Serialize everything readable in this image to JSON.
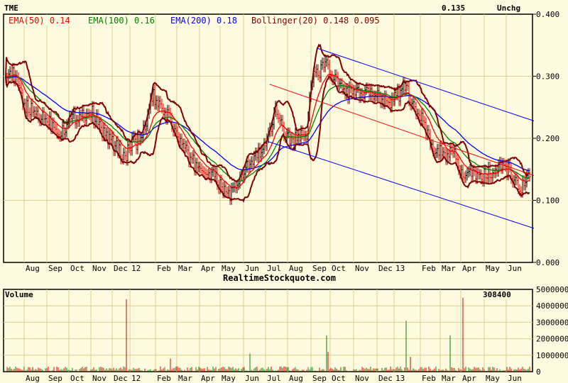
{
  "header": {
    "symbol": "TME",
    "last": "0.135",
    "change": "Unchg"
  },
  "legend": [
    {
      "label": "EMA(50)",
      "value": "0.14",
      "color": "#ff0000"
    },
    {
      "label": "EMA(100)",
      "value": "0.16",
      "color": "#008000"
    },
    {
      "label": "EMA(200)",
      "value": "0.18",
      "color": "#0000ff"
    },
    {
      "label": "Bollinger(20)",
      "value": "0.148 0.095",
      "color": "#800000"
    }
  ],
  "watermark": "RealtimeStockquote.com",
  "chart_data": [
    {
      "type": "line",
      "title": "TME",
      "x_tick_labels": [
        "Aug",
        "Sep",
        "Oct",
        "Nov",
        "Dec",
        "12",
        "Feb",
        "Mar",
        "Apr",
        "May",
        "Jun",
        "Jul",
        "Aug",
        "Sep",
        "Oct",
        "Nov",
        "Dec",
        "13",
        "Feb",
        "Mar",
        "Apr",
        "May",
        "Jun"
      ],
      "x_tick_days": [
        30,
        62,
        93,
        124,
        154,
        179,
        215,
        245,
        277,
        306,
        339,
        370,
        401,
        434,
        461,
        494,
        527,
        551,
        588,
        616,
        645,
        678,
        709
      ],
      "y_ticks": [
        "0.000",
        "0.100",
        "0.200",
        "0.300",
        "0.400"
      ],
      "ylim": [
        0,
        0.4
      ],
      "grid": true,
      "close_points": [
        [
          0,
          0.31
        ],
        [
          12,
          0.3
        ],
        [
          28,
          0.25
        ],
        [
          42,
          0.24
        ],
        [
          60,
          0.23
        ],
        [
          77,
          0.21
        ],
        [
          91,
          0.23
        ],
        [
          107,
          0.24
        ],
        [
          122,
          0.24
        ],
        [
          137,
          0.21
        ],
        [
          152,
          0.19
        ],
        [
          167,
          0.17
        ],
        [
          177,
          0.19
        ],
        [
          192,
          0.2
        ],
        [
          207,
          0.27
        ],
        [
          213,
          0.25
        ],
        [
          227,
          0.24
        ],
        [
          243,
          0.2
        ],
        [
          257,
          0.17
        ],
        [
          275,
          0.15
        ],
        [
          292,
          0.14
        ],
        [
          304,
          0.12
        ],
        [
          317,
          0.11
        ],
        [
          327,
          0.12
        ],
        [
          337,
          0.15
        ],
        [
          352,
          0.17
        ],
        [
          368,
          0.19
        ],
        [
          382,
          0.25
        ],
        [
          392,
          0.21
        ],
        [
          399,
          0.2
        ],
        [
          412,
          0.2
        ],
        [
          424,
          0.21
        ],
        [
          432,
          0.3
        ],
        [
          442,
          0.31
        ],
        [
          452,
          0.32
        ],
        [
          459,
          0.3
        ],
        [
          472,
          0.28
        ],
        [
          492,
          0.27
        ],
        [
          512,
          0.27
        ],
        [
          525,
          0.27
        ],
        [
          542,
          0.26
        ],
        [
          562,
          0.28
        ],
        [
          577,
          0.25
        ],
        [
          586,
          0.23
        ],
        [
          602,
          0.18
        ],
        [
          614,
          0.18
        ],
        [
          632,
          0.17
        ],
        [
          643,
          0.14
        ],
        [
          657,
          0.14
        ],
        [
          676,
          0.14
        ],
        [
          692,
          0.15
        ],
        [
          707,
          0.15
        ],
        [
          722,
          0.12
        ],
        [
          738,
          0.135
        ]
      ],
      "channel": [
        {
          "name": "upper",
          "color": "#0000ff",
          "from": [
            439,
            0.345
          ],
          "to": [
            744,
            0.228
          ]
        },
        {
          "name": "middle",
          "color": "#ff0000",
          "from": [
            372,
            0.287
          ],
          "to": [
            744,
            0.14
          ]
        },
        {
          "name": "lower",
          "color": "#0000ff",
          "from": [
            369,
            0.195
          ],
          "to": [
            744,
            0.055
          ]
        }
      ]
    },
    {
      "type": "bar",
      "title": "Volume",
      "last_volume": "308400",
      "y_ticks": [
        "0",
        "1000000",
        "2000000",
        "3000000",
        "4000000",
        "5000000"
      ],
      "ylim": [
        0,
        5000000
      ],
      "spikes": [
        [
          170,
          4400000
        ],
        [
          344,
          1100000
        ],
        [
          453,
          2200000
        ],
        [
          455,
          1200000
        ],
        [
          565,
          3100000
        ],
        [
          627,
          2200000
        ],
        [
          644,
          4500000
        ],
        [
          232,
          800000
        ],
        [
          570,
          900000
        ]
      ]
    }
  ]
}
